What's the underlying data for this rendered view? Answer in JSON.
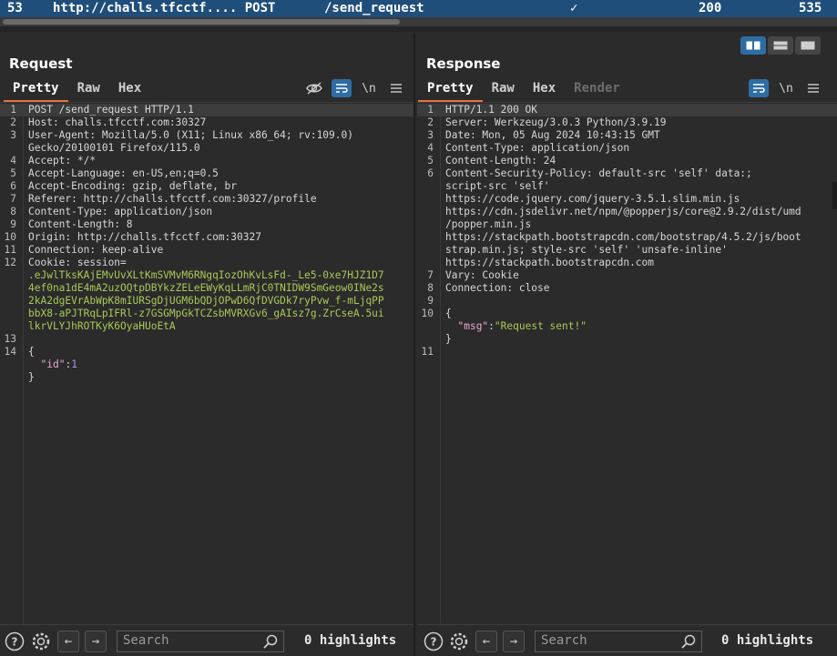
{
  "history_row": {
    "index": "53",
    "host": "http://challs.tfcctf.... POST",
    "path": "/send_request",
    "check": "✓",
    "status": "200",
    "length": "535"
  },
  "request": {
    "title": "Request",
    "tabs": [
      "Pretty",
      "Raw",
      "Hex"
    ],
    "newline_label": "\\n",
    "lines": [
      {
        "n": "1",
        "parts": [
          {
            "t": "POST /send_request HTTP/1.1",
            "c": "hdr"
          }
        ]
      },
      {
        "n": "2",
        "parts": [
          {
            "t": "Host: ",
            "c": "hdr"
          },
          {
            "t": "challs.tfcctf.com:30327",
            "c": "val"
          }
        ]
      },
      {
        "n": "3",
        "parts": [
          {
            "t": "User-Agent: ",
            "c": "hdr"
          },
          {
            "t": "Mozilla/5.0 (X11; Linux x86_64; rv:109.0)",
            "c": "val"
          }
        ]
      },
      {
        "n": "",
        "parts": [
          {
            "t": "Gecko/20100101 Firefox/115.0",
            "c": "val"
          }
        ]
      },
      {
        "n": "4",
        "parts": [
          {
            "t": "Accept: ",
            "c": "hdr"
          },
          {
            "t": "*/*",
            "c": "val"
          }
        ]
      },
      {
        "n": "5",
        "parts": [
          {
            "t": "Accept-Language: ",
            "c": "hdr"
          },
          {
            "t": "en-US,en;q=0.5",
            "c": "val"
          }
        ]
      },
      {
        "n": "6",
        "parts": [
          {
            "t": "Accept-Encoding: ",
            "c": "hdr"
          },
          {
            "t": "gzip, deflate, br",
            "c": "val"
          }
        ]
      },
      {
        "n": "7",
        "parts": [
          {
            "t": "Referer: ",
            "c": "hdr"
          },
          {
            "t": "http://challs.tfcctf.com:30327/profile",
            "c": "val"
          }
        ]
      },
      {
        "n": "8",
        "parts": [
          {
            "t": "Content-Type: ",
            "c": "hdr"
          },
          {
            "t": "application/json",
            "c": "val"
          }
        ]
      },
      {
        "n": "9",
        "parts": [
          {
            "t": "Content-Length: ",
            "c": "hdr"
          },
          {
            "t": "8",
            "c": "val"
          }
        ]
      },
      {
        "n": "10",
        "parts": [
          {
            "t": "Origin: ",
            "c": "hdr"
          },
          {
            "t": "http://challs.tfcctf.com:30327",
            "c": "val"
          }
        ]
      },
      {
        "n": "11",
        "parts": [
          {
            "t": "Connection: ",
            "c": "hdr"
          },
          {
            "t": "keep-alive",
            "c": "val"
          }
        ]
      },
      {
        "n": "12",
        "parts": [
          {
            "t": "Cookie: ",
            "c": "hdr"
          },
          {
            "t": "session=",
            "c": "val"
          }
        ]
      },
      {
        "n": "",
        "parts": [
          {
            "t": ".eJwlTksKAjEMvUvXLtKmSVMvM6RNgqIozOhKvLsFd-_Le5-0xe7HJZ1D7",
            "c": "ck"
          }
        ]
      },
      {
        "n": "",
        "parts": [
          {
            "t": "4ef0na1dE4mA2uzOQtpDBYkzZELeEWyKqLLmRjC0TNIDW9SmGeow0INe2s",
            "c": "ck"
          }
        ]
      },
      {
        "n": "",
        "parts": [
          {
            "t": "2kA2dgEVrAbWpK8mIURSgDjUGM6bQDjOPwD6QfDVGDk7ryPvw_f-mLjqPP",
            "c": "ck"
          }
        ]
      },
      {
        "n": "",
        "parts": [
          {
            "t": "bbX8-aPJTRqLpIFRl-z7GSGMpGkTCZsbMVRXGv6_gAIsz7g.ZrCseA.5ui",
            "c": "ck"
          }
        ]
      },
      {
        "n": "",
        "parts": [
          {
            "t": "lkrVLYJhROTKyK6OyaHUoEtA",
            "c": "ck"
          }
        ]
      },
      {
        "n": "13",
        "parts": []
      },
      {
        "n": "14",
        "parts": [
          {
            "t": "{",
            "c": "val"
          }
        ]
      },
      {
        "n": "",
        "parts": [
          {
            "t": "  ",
            "c": "val"
          },
          {
            "t": "\"id\"",
            "c": "jk"
          },
          {
            "t": ":",
            "c": "val"
          },
          {
            "t": "1",
            "c": "jn"
          }
        ]
      },
      {
        "n": "",
        "parts": [
          {
            "t": "}",
            "c": "val"
          }
        ]
      }
    ],
    "search_placeholder": "Search",
    "highlights": "0 highlights"
  },
  "response": {
    "title": "Response",
    "tabs": [
      "Pretty",
      "Raw",
      "Hex",
      "Render"
    ],
    "newline_label": "\\n",
    "lines": [
      {
        "n": "1",
        "parts": [
          {
            "t": "HTTP/1.1 200 OK",
            "c": "hdr"
          }
        ]
      },
      {
        "n": "2",
        "parts": [
          {
            "t": "Server: ",
            "c": "hdr"
          },
          {
            "t": "Werkzeug/3.0.3 Python/3.9.19",
            "c": "val"
          }
        ]
      },
      {
        "n": "3",
        "parts": [
          {
            "t": "Date: ",
            "c": "hdr"
          },
          {
            "t": "Mon, 05 Aug 2024 10:43:15 GMT",
            "c": "val"
          }
        ]
      },
      {
        "n": "4",
        "parts": [
          {
            "t": "Content-Type: ",
            "c": "hdr"
          },
          {
            "t": "application/json",
            "c": "val"
          }
        ]
      },
      {
        "n": "5",
        "parts": [
          {
            "t": "Content-Length: ",
            "c": "hdr"
          },
          {
            "t": "24",
            "c": "val"
          }
        ]
      },
      {
        "n": "6",
        "parts": [
          {
            "t": "Content-Security-Policy: ",
            "c": "hdr"
          },
          {
            "t": "default-src 'self' data:;",
            "c": "val"
          }
        ]
      },
      {
        "n": "",
        "parts": [
          {
            "t": "script-src 'self'",
            "c": "val"
          }
        ]
      },
      {
        "n": "",
        "parts": [
          {
            "t": "https://code.jquery.com/jquery-3.5.1.slim.min.js",
            "c": "val"
          }
        ]
      },
      {
        "n": "",
        "parts": [
          {
            "t": "https://cdn.jsdelivr.net/npm/@popperjs/core@2.9.2/dist/umd",
            "c": "val"
          }
        ]
      },
      {
        "n": "",
        "parts": [
          {
            "t": "/popper.min.js",
            "c": "val"
          }
        ]
      },
      {
        "n": "",
        "parts": [
          {
            "t": "https://stackpath.bootstrapcdn.com/bootstrap/4.5.2/js/boot",
            "c": "val"
          }
        ]
      },
      {
        "n": "",
        "parts": [
          {
            "t": "strap.min.js; style-src 'self' 'unsafe-inline'",
            "c": "val"
          }
        ]
      },
      {
        "n": "",
        "parts": [
          {
            "t": "https://stackpath.bootstrapcdn.com",
            "c": "val"
          }
        ]
      },
      {
        "n": "7",
        "parts": [
          {
            "t": "Vary: ",
            "c": "hdr"
          },
          {
            "t": "Cookie",
            "c": "val"
          }
        ]
      },
      {
        "n": "8",
        "parts": [
          {
            "t": "Connection: ",
            "c": "hdr"
          },
          {
            "t": "close",
            "c": "val"
          }
        ]
      },
      {
        "n": "9",
        "parts": []
      },
      {
        "n": "10",
        "parts": [
          {
            "t": "{",
            "c": "val"
          }
        ]
      },
      {
        "n": "",
        "parts": [
          {
            "t": "  ",
            "c": "val"
          },
          {
            "t": "\"msg\"",
            "c": "jk"
          },
          {
            "t": ":",
            "c": "val"
          },
          {
            "t": "\"Request sent!\"",
            "c": "js"
          }
        ]
      },
      {
        "n": "",
        "parts": [
          {
            "t": "}",
            "c": "val"
          }
        ]
      },
      {
        "n": "11",
        "parts": []
      }
    ],
    "search_placeholder": "Search",
    "highlights": "0 highlights"
  },
  "colors": {
    "accent": "#e8743b",
    "selected_row": "#1f4e7a",
    "toggle_active": "#2e6da4"
  },
  "icons": {
    "help": "help-icon",
    "settings": "gear-icon",
    "back": "arrow-left-icon",
    "forward": "arrow-right-icon",
    "search": "search-icon",
    "menu": "hamburger-icon",
    "wrap": "wrap-text-icon",
    "hide": "eye-off-icon"
  }
}
